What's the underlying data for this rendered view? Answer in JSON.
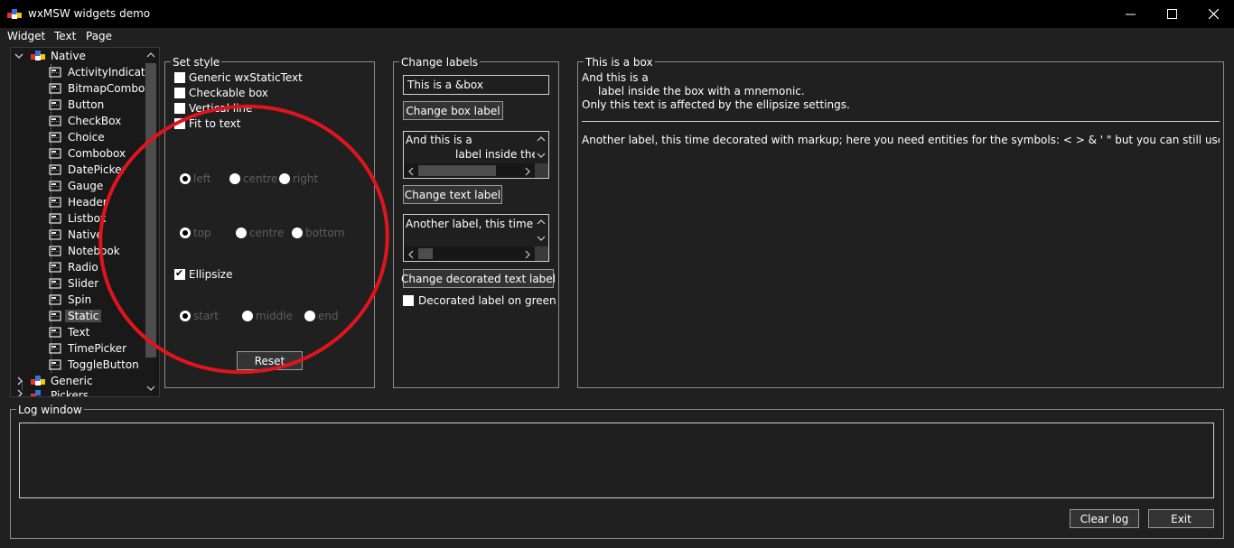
{
  "window": {
    "title": "wxMSW widgets demo"
  },
  "menu": [
    "Widget",
    "Text",
    "Page"
  ],
  "tree": {
    "native_label": "Native",
    "items": [
      "ActivityIndicator",
      "BitmapCombobox",
      "Button",
      "CheckBox",
      "Choice",
      "Combobox",
      "DatePicker",
      "Gauge",
      "Header",
      "Listbox",
      "Native",
      "Notebook",
      "Radio",
      "Slider",
      "Spin",
      "Static",
      "Text",
      "TimePicker",
      "ToggleButton"
    ],
    "selected": "Static",
    "generic_label": "Generic",
    "pickers_label": "Pickers"
  },
  "set_style": {
    "title": "Set style",
    "checks": [
      {
        "label": "Generic wxStaticText",
        "checked": false
      },
      {
        "label": "Checkable box",
        "checked": false
      },
      {
        "label": "Vertical line",
        "checked": false
      },
      {
        "label": "Fit to text",
        "checked": true
      }
    ],
    "halign": [
      "left",
      "centre",
      "right"
    ],
    "valign": [
      "top",
      "centre",
      "bottom"
    ],
    "ellipsize_label": "Ellipsize",
    "ellipsize_modes": [
      "start",
      "middle",
      "end"
    ],
    "reset_label": "Reset"
  },
  "change_labels": {
    "title": "Change labels",
    "box_label_value": "This is a &box",
    "change_box_label": "Change box label",
    "text_label_line1": "And this is a",
    "text_label_line2": "label inside the b",
    "change_text_label": "Change text label",
    "decorated_value": "Another label, this time <b",
    "change_decorated_label": "Change decorated text label",
    "decorated_on_green": "Decorated label on green"
  },
  "box": {
    "title": "This is a box",
    "line1": "And this is a",
    "line2": "label inside the box with a mnemonic.",
    "line3": "Only this text is affected by the ellipsize settings.",
    "markup_label": "Another label, this time decorated with markup; here you need entities for the symbols: < > & ' \"  but you can still use mnemonics too"
  },
  "log": {
    "title": "Log window",
    "clear_label": "Clear log",
    "exit_label": "Exit"
  },
  "colors": {
    "background": "#202020",
    "titlebar": "#000000",
    "annotation": "#e0141e"
  }
}
